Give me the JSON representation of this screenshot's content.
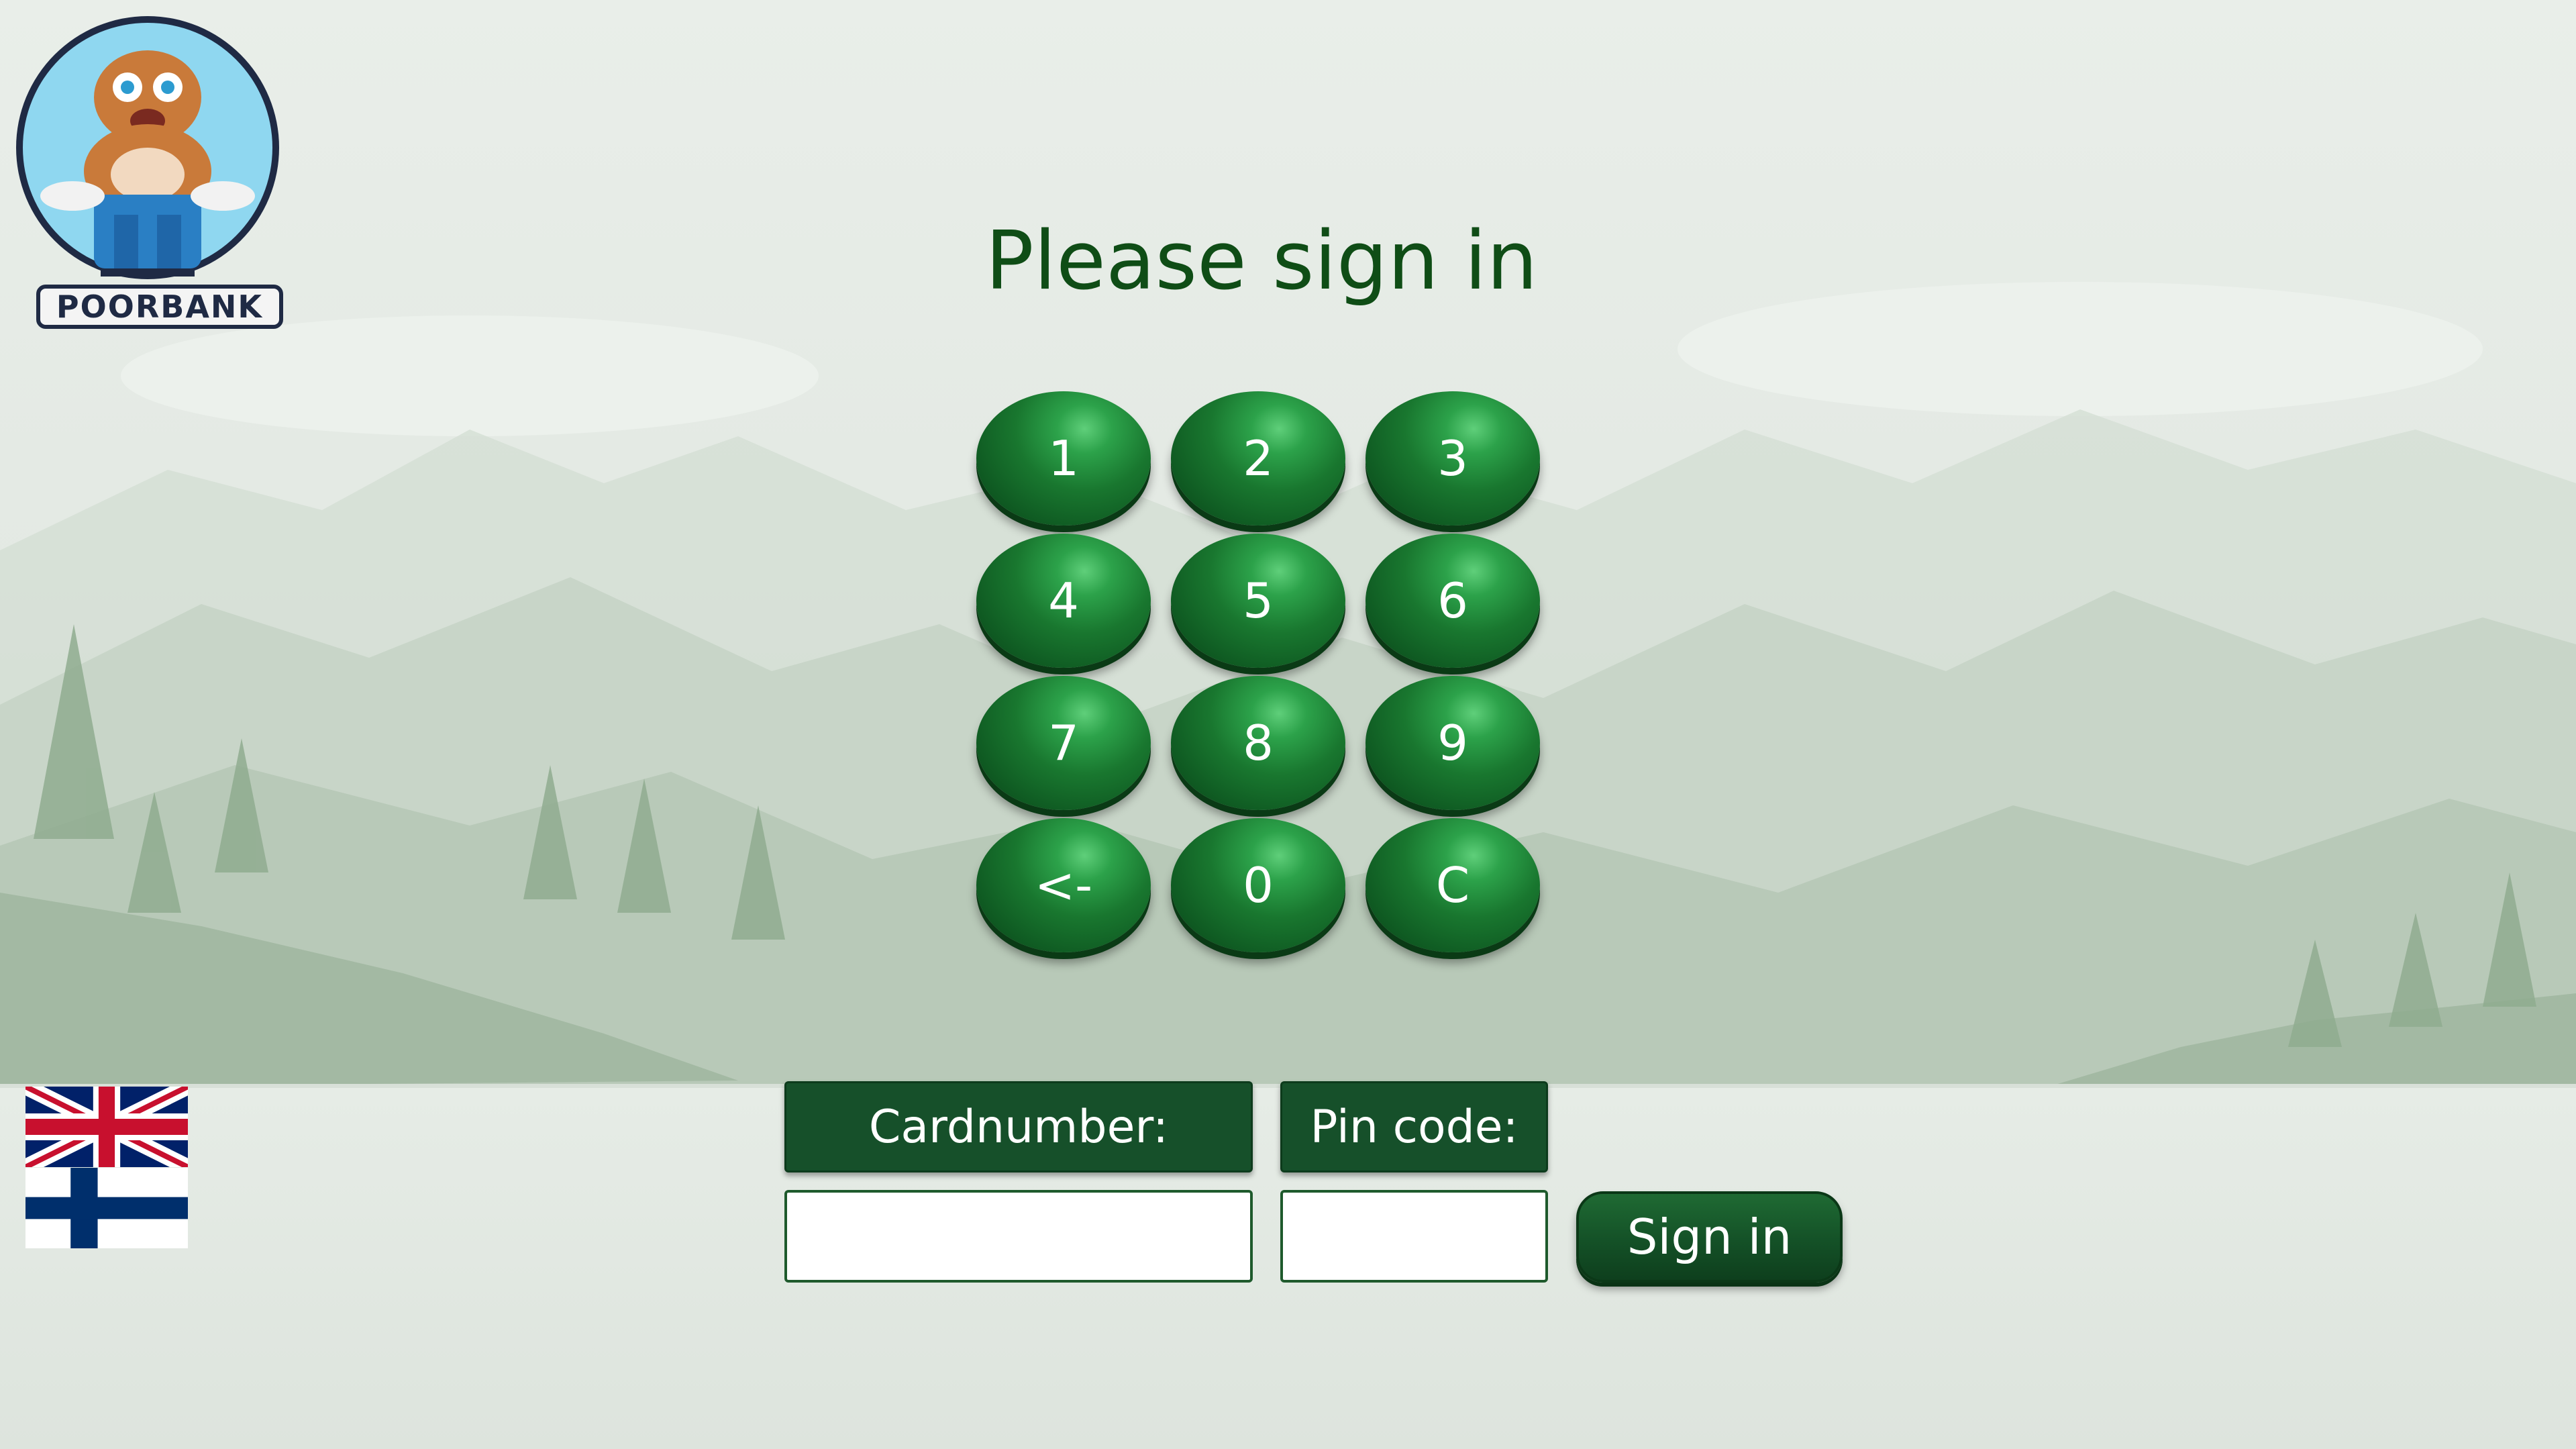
{
  "logo": {
    "text": "POORBANK"
  },
  "title": "Please sign in",
  "keypad": {
    "keys": [
      "1",
      "2",
      "3",
      "4",
      "5",
      "6",
      "7",
      "8",
      "9",
      "<-",
      "0",
      "C"
    ]
  },
  "form": {
    "cardnumber_label": "Cardnumber:",
    "pincode_label": "Pin code:",
    "cardnumber_value": "",
    "pincode_value": "",
    "signin_label": "Sign in"
  },
  "languages": [
    {
      "name": "English",
      "icon": "uk-flag-icon"
    },
    {
      "name": "Finnish",
      "icon": "finland-flag-icon"
    }
  ],
  "colors": {
    "title": "#0f4d16",
    "key_green": "#19772f",
    "label_bg": "#16502a",
    "button_bg": "#145127"
  }
}
